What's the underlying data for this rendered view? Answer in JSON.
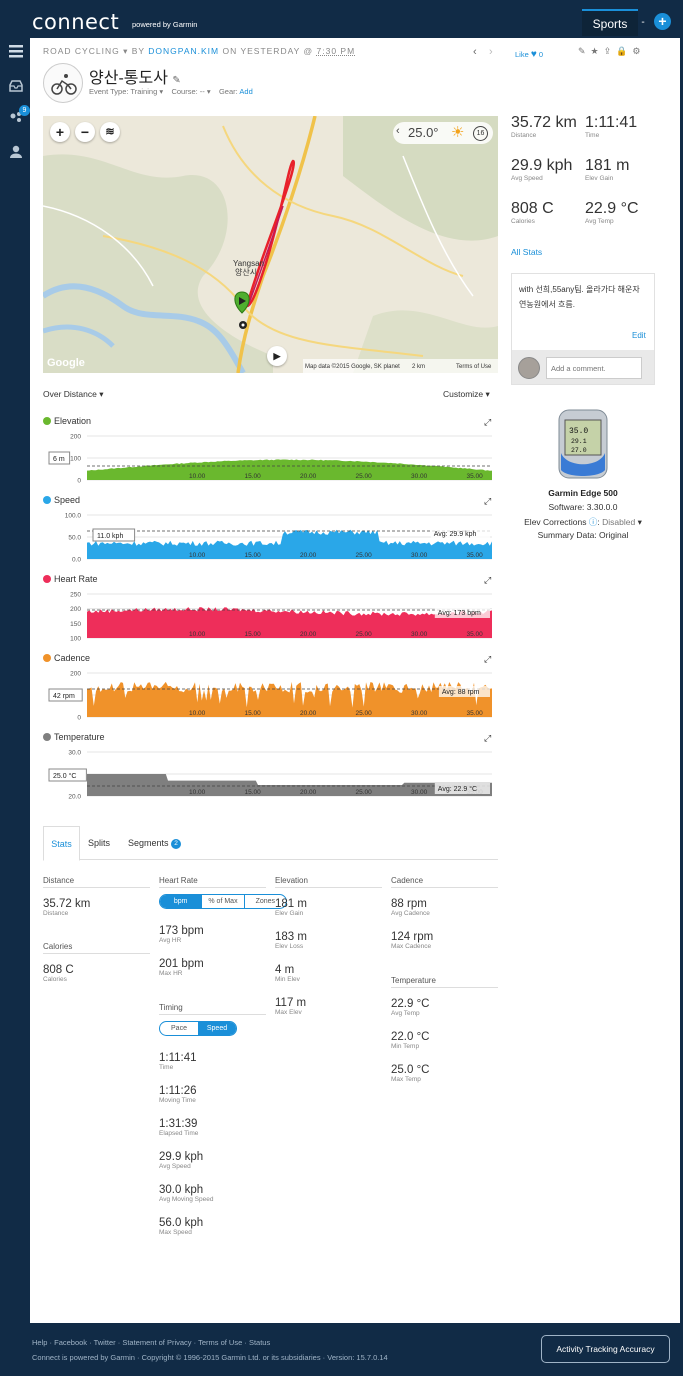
{
  "header": {
    "logo": "connect",
    "powered": "powered by Garmin",
    "sports_tab": "Sports",
    "dash": "-",
    "plus": "+"
  },
  "sidebar": {
    "badge": "9"
  },
  "activity": {
    "type": "ROAD CYCLING",
    "by": "BY",
    "author": "DONGPAN.KIM",
    "on": "ON YESTERDAY @",
    "time": "7:30 PM",
    "title": "양산-통도사",
    "event_type": "Event Type: Training",
    "course": "Course: --",
    "gear_label": "Gear:",
    "gear_add": "Add",
    "like": "Like",
    "like_count": "0"
  },
  "map": {
    "temp": "25.0°",
    "wind": "16",
    "city_en": "Yangsan",
    "city_ko": "양산시",
    "attribution": "Map data ©2015 Google, SK planet",
    "scale": "2 km",
    "terms": "Terms of Use",
    "google": "Google"
  },
  "summary": [
    {
      "value": "35.72 km",
      "label": "Distance"
    },
    {
      "value": "1:11:41",
      "label": "Time"
    },
    {
      "value": "29.9 kph",
      "label": "Avg Speed"
    },
    {
      "value": "181 m",
      "label": "Elev Gain"
    },
    {
      "value": "808 C",
      "label": "Calories"
    },
    {
      "value": "22.9 °C",
      "label": "Avg Temp"
    }
  ],
  "all_stats": "All Stats",
  "notes": {
    "text": "with 선희,55any팀. 올라가다 해운자연농원에서 흐름.",
    "edit": "Edit",
    "comment_placeholder": "Add a comment."
  },
  "device": {
    "name": "Garmin Edge 500",
    "software": "Software: 3.30.0.0",
    "elev_label": "Elev Corrections",
    "elev_value": "Disabled",
    "summary": "Summary Data: Original",
    "screen_top": "35.0",
    "screen_mid": "29.1",
    "screen_bot": "27.0"
  },
  "graphs": {
    "over": "Over Distance",
    "customize": "Customize",
    "x_ticks": [
      "10.00",
      "15.00",
      "20.00",
      "25.00",
      "30.00",
      "35.00"
    ],
    "items": [
      {
        "name": "Elevation",
        "color": "#6ab82e",
        "ticks": [
          "200",
          "100",
          "0"
        ],
        "marker": "6 m",
        "avg": ""
      },
      {
        "name": "Speed",
        "color": "#2aa7e8",
        "ticks": [
          "100.0",
          "50.0",
          "0.0"
        ],
        "marker": "11.0 kph",
        "avg": "Avg: 29.9 kph"
      },
      {
        "name": "Heart Rate",
        "color": "#ee2e5a",
        "ticks": [
          "250",
          "200",
          "150",
          "100"
        ],
        "marker": "",
        "avg": "Avg: 173 bpm"
      },
      {
        "name": "Cadence",
        "color": "#f0922a",
        "ticks": [
          "200",
          "100",
          "0"
        ],
        "marker": "42 rpm",
        "avg": "Avg: 88 rpm"
      },
      {
        "name": "Temperature",
        "color": "#7f7f7f",
        "ticks": [
          "30.0",
          "25.0",
          "20.0"
        ],
        "marker": "25.0 °C",
        "avg": "Avg: 22.9 °C"
      }
    ]
  },
  "tabs": {
    "stats": "Stats",
    "splits": "Splits",
    "segments": "Segments",
    "segments_count": "2"
  },
  "stats": {
    "distance": {
      "title": "Distance",
      "value": "35.72 km",
      "label": "Distance"
    },
    "calories": {
      "title": "Calories",
      "value": "808 C",
      "label": "Calories"
    },
    "heart_rate": {
      "title": "Heart Rate",
      "toggle": [
        "bpm",
        "% of Max",
        "Zones"
      ],
      "items": [
        {
          "value": "173 bpm",
          "label": "Avg HR"
        },
        {
          "value": "201 bpm",
          "label": "Max HR"
        }
      ]
    },
    "timing": {
      "title": "Timing",
      "toggle": [
        "Pace",
        "Speed"
      ],
      "items": [
        {
          "value": "1:11:41",
          "label": "Time"
        },
        {
          "value": "1:11:26",
          "label": "Moving Time"
        },
        {
          "value": "1:31:39",
          "label": "Elapsed Time"
        },
        {
          "value": "29.9 kph",
          "label": "Avg Speed"
        },
        {
          "value": "30.0 kph",
          "label": "Avg Moving Speed"
        },
        {
          "value": "56.0 kph",
          "label": "Max Speed"
        }
      ]
    },
    "elevation": {
      "title": "Elevation",
      "items": [
        {
          "value": "181 m",
          "label": "Elev Gain"
        },
        {
          "value": "183 m",
          "label": "Elev Loss"
        },
        {
          "value": "4 m",
          "label": "Min Elev"
        },
        {
          "value": "117 m",
          "label": "Max Elev"
        }
      ]
    },
    "cadence": {
      "title": "Cadence",
      "items": [
        {
          "value": "88 rpm",
          "label": "Avg Cadence"
        },
        {
          "value": "124 rpm",
          "label": "Max Cadence"
        }
      ]
    },
    "temperature": {
      "title": "Temperature",
      "items": [
        {
          "value": "22.9 °C",
          "label": "Avg Temp"
        },
        {
          "value": "22.0 °C",
          "label": "Min Temp"
        },
        {
          "value": "25.0 °C",
          "label": "Max Temp"
        }
      ]
    }
  },
  "footer": {
    "links": [
      "Help",
      "Facebook",
      "Twitter",
      "Statement of Privacy",
      "Terms of Use",
      "Status"
    ],
    "copyright": "Connect is powered by Garmin · Copyright © 1996-2015 Garmin Ltd. or its subsidiaries · Version: 15.7.0.14",
    "button": "Activity Tracking Accuracy"
  }
}
